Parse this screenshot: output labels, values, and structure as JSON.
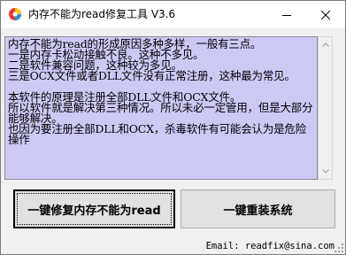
{
  "window": {
    "title": "内存不能为read修复工具 V3.6"
  },
  "info": {
    "text": "内存不能为read的形成原因多种多样，一般有三点。\n一是内存卡松动接触不良。这种不多见。\n二是软件兼容问题，这种较为多见。\n三是OCX文件或者DLL文件没有正常注册，这种最为常见。\n\n本软件的原理是注册全部DLL文件和OCX文件。\n所以软件就是解决第三种情况。所以未必一定管用，但是大部分\n能够解决。\n也因为要注册全部DLL和OCX，杀毒软件有可能会认为是危险操作"
  },
  "buttons": {
    "fix_read": "一键修复内存不能为read",
    "reinstall": "一键重装系统"
  },
  "footer": {
    "email": "Email: readfix@sina.com"
  },
  "colors": {
    "panel_bg": "#cdc9f5",
    "window_bg": "#f0f0f0"
  }
}
